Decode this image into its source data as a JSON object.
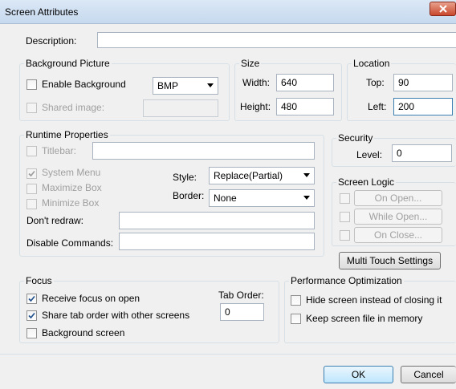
{
  "window": {
    "title": "Screen Attributes"
  },
  "description": {
    "label": "Description:",
    "value": ""
  },
  "background_picture": {
    "group_label": "Background Picture",
    "enable_label": "Enable Background",
    "format_value": "BMP",
    "shared_label": "Shared image:",
    "shared_value": ""
  },
  "size": {
    "group_label": "Size",
    "width_label": "Width:",
    "width_value": "640",
    "height_label": "Height:",
    "height_value": "480"
  },
  "location": {
    "group_label": "Location",
    "top_label": "Top:",
    "top_value": "90",
    "left_label": "Left:",
    "left_value": "200"
  },
  "runtime": {
    "group_label": "Runtime Properties",
    "titlebar_label": "Titlebar:",
    "titlebar_value": "",
    "system_menu_label": "System Menu",
    "maximize_label": "Maximize Box",
    "minimize_label": "Minimize Box",
    "style_label": "Style:",
    "style_value": "Replace(Partial)",
    "border_label": "Border:",
    "border_value": "None",
    "dont_redraw_label": "Don't redraw:",
    "dont_redraw_value": "",
    "disable_commands_label": "Disable Commands:",
    "disable_commands_value": ""
  },
  "security": {
    "group_label": "Security",
    "level_label": "Level:",
    "level_value": "0"
  },
  "screen_logic": {
    "group_label": "Screen Logic",
    "on_open": "On Open...",
    "while_open": "While Open...",
    "on_close": "On Close..."
  },
  "multi_touch_label": "Multi Touch Settings",
  "focus": {
    "group_label": "Focus",
    "receive_focus_label": "Receive focus on open",
    "share_tab_label": "Share tab order with other screens",
    "background_screen_label": "Background screen",
    "tab_order_label": "Tab Order:",
    "tab_order_value": "0"
  },
  "performance": {
    "group_label": "Performance Optimization",
    "hide_screen_label": "Hide screen instead of closing it",
    "keep_file_label": "Keep screen file in memory"
  },
  "buttons": {
    "ok": "OK",
    "cancel": "Cancel"
  }
}
